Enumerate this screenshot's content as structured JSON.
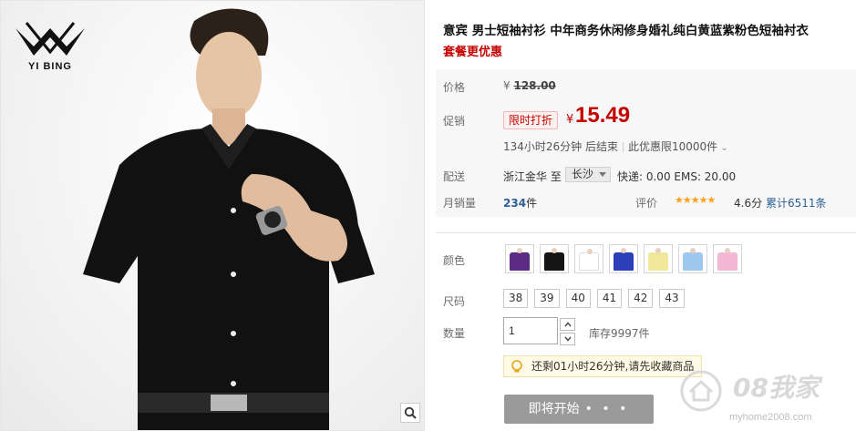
{
  "brand": {
    "logo_text": "YI BING"
  },
  "product": {
    "title": "意宾 男士短袖衬衫 中年商务休闲修身婚礼纯白黄蓝紫粉色短袖衬衣",
    "subtitle": "套餐更优惠"
  },
  "price": {
    "label": "价格",
    "currency": "¥",
    "original": "128.00",
    "promo_label": "促销",
    "promo_tag": "限时打折",
    "promo_currency": "¥",
    "promo_price": "15.49",
    "countdown": "134小时26分钟 后结束",
    "limit_text": "此优惠限10000件"
  },
  "shipping": {
    "label": "配送",
    "from": "浙江金华",
    "to_word": "至",
    "destination": "长沙",
    "fees": "快递: 0.00 EMS: 20.00"
  },
  "sales": {
    "label": "月销量",
    "count": "234",
    "unit": "件",
    "rating_label": "评价",
    "stars": "★★★★★",
    "score": "4.6分",
    "reviews": "累计6511条"
  },
  "options": {
    "color_label": "颜色",
    "colors": [
      {
        "name": "purple",
        "hex": "#5b2b86"
      },
      {
        "name": "black",
        "hex": "#151515"
      },
      {
        "name": "white",
        "hex": "#ffffff"
      },
      {
        "name": "blue",
        "hex": "#2b3fb8"
      },
      {
        "name": "yellow",
        "hex": "#f1e79a"
      },
      {
        "name": "light-blue",
        "hex": "#9fc8ef"
      },
      {
        "name": "pink",
        "hex": "#f3b6d4"
      }
    ],
    "size_label": "尺码",
    "sizes": [
      "38",
      "39",
      "40",
      "41",
      "42",
      "43"
    ],
    "qty_label": "数量",
    "qty_value": "1",
    "stock": "库存9997件"
  },
  "tip": "还剩01小时26分钟,请先收藏商品",
  "buy_button": {
    "label": "即将开始",
    "dots": "• • •"
  },
  "watermark": {
    "brand": "08我家",
    "site": "myhome2008.com"
  },
  "colors": {
    "accent_red": "#c40000",
    "link_blue": "#2b5f9a",
    "star_orange": "#ff9e1b",
    "button_gray": "#9a9a9a"
  }
}
